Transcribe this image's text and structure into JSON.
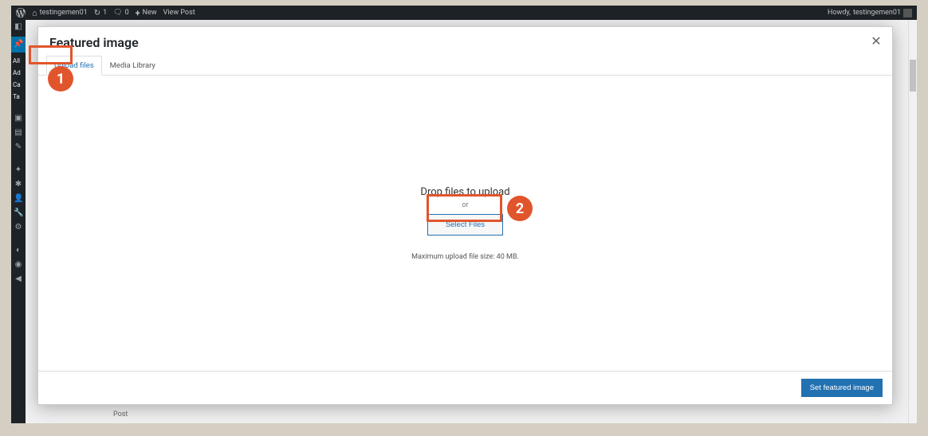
{
  "admin_bar": {
    "site_name": "testingemen01",
    "updates_count": "1",
    "comments_count": "0",
    "new_label": "New",
    "view_post_label": "View Post",
    "howdy_prefix": "Howdy,",
    "user_name": "testingemen01"
  },
  "sidebar": {
    "items": [
      {
        "label": "All"
      },
      {
        "label": "Ad"
      },
      {
        "label": "Ca"
      },
      {
        "label": "Ta"
      }
    ]
  },
  "modal": {
    "title": "Featured image",
    "tabs": {
      "upload": "Upload files",
      "library": "Media Library"
    },
    "drop_text": "Drop files to upload",
    "or_text": "or",
    "select_btn": "Select Files",
    "max_size": "Maximum upload file size: 40 MB.",
    "submit_btn": "Set featured image"
  },
  "callouts": {
    "one": "1",
    "two": "2"
  },
  "background": {
    "bottom_word": "Post"
  }
}
